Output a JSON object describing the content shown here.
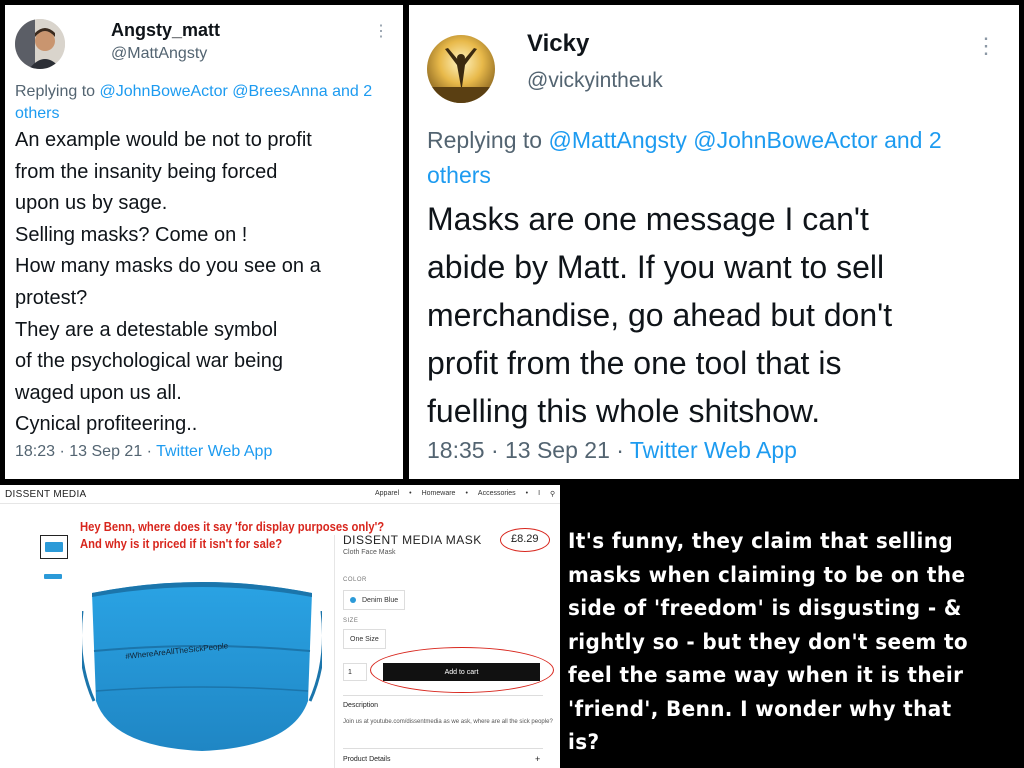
{
  "tweet1": {
    "display_name": "Angsty_matt",
    "handle": "@MattAngsty",
    "reply_prefix": "Replying to ",
    "reply_targets": "@JohnBoweActor @BreesAnna and 2 others",
    "body": "An example would be not to profit\nfrom the insanity being forced\nupon us by sage.\nSelling masks? Come on !\nHow many masks do you see on a\nprotest?\nThey are a detestable symbol\nof the psychological war being\nwaged upon us all.\nCynical profiteering..",
    "timestamp": "18:23 · 13 Sep 21 · ",
    "source": "Twitter Web App",
    "more_icon": "⋮"
  },
  "tweet2": {
    "display_name": "Vicky",
    "handle": "@vickyintheuk",
    "reply_prefix": "Replying to ",
    "reply_targets": "@MattAngsty @JohnBoweActor and 2 others",
    "body": "Masks are one message I can't\nabide by Matt. If you want to sell\nmerchandise, go ahead but don't\nprofit from the one tool that is\nfuelling this whole shitshow.",
    "timestamp": "18:35 · 13 Sep 21 · ",
    "source": "Twitter Web App",
    "more_icon": "⋮"
  },
  "store": {
    "logo": "DISSENT MEDIA",
    "nav": [
      "Apparel",
      "•",
      "Homeware",
      "•",
      "Accessories",
      "•",
      "I",
      "⚲"
    ],
    "annotation": "Hey Benn, where does it say 'for display purposes only'?\nAnd why is it priced if it isn't for sale?",
    "product_title": "DISSENT MEDIA MASK",
    "product_subtitle": "Cloth Face Mask",
    "price": "£8.29",
    "color_label": "COLOR",
    "color_value": "Denim Blue",
    "size_label": "SIZE",
    "size_value": "One Size",
    "quantity": "1",
    "add_to_cart": "Add to cart",
    "description_heading": "Description",
    "description_text": "Join us at youtube.com/dissentmedia as we ask, where are all the sick people?",
    "details_heading": "Product Details",
    "details_toggle": "+",
    "mask_print": "#WhereAreAllTheSickPeople"
  },
  "commentary": {
    "text": "It's funny, they claim that selling\nmasks when claiming to be on the\nside of 'freedom' is disgusting - &\nrightly so - but they don't seem to\nfeel the same way when it is their\n'friend', Benn. I wonder why that is?"
  },
  "colors": {
    "twitter_blue": "#1d9bf0",
    "annotation_red": "#d8261d",
    "mask_blue": "#2b9ad8"
  }
}
